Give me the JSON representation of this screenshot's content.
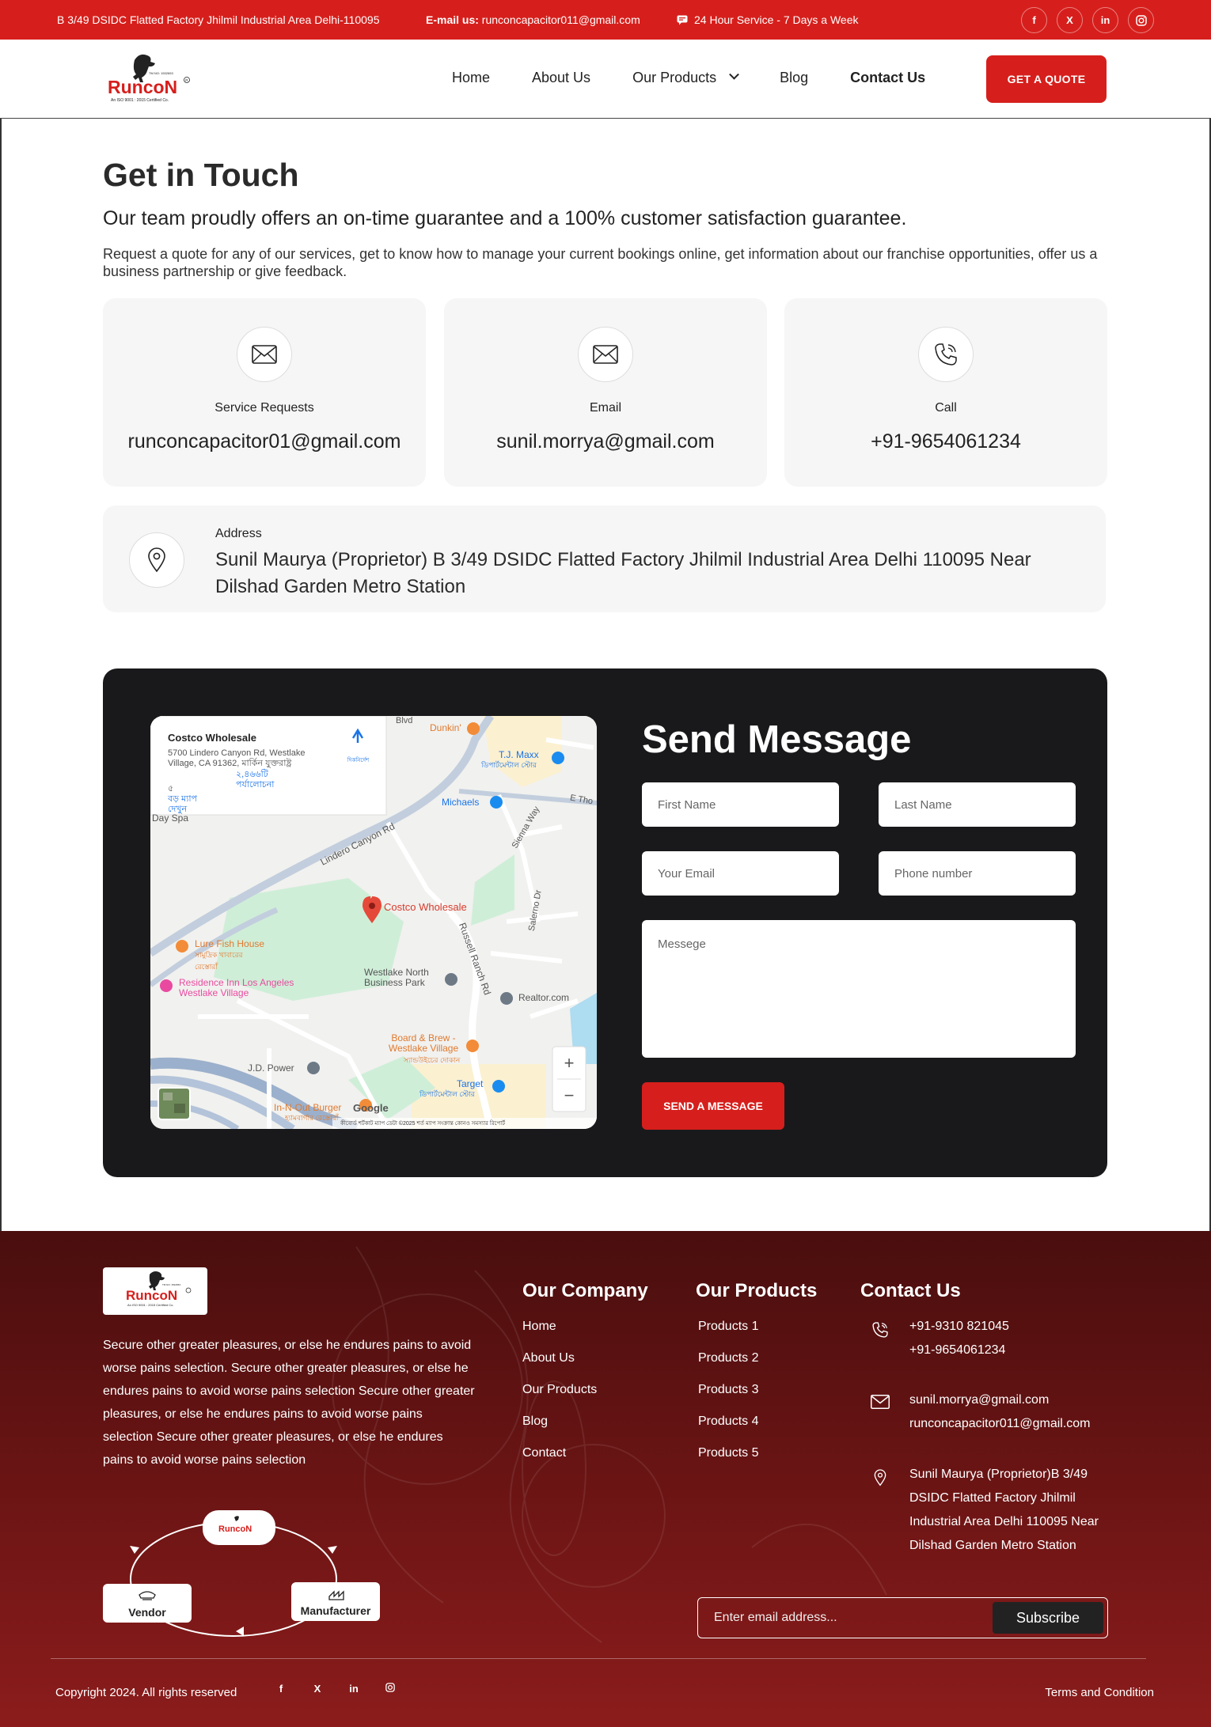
{
  "topbar": {
    "address": "B 3/49 DSIDC Flatted Factory Jhilmil Industrial Area Delhi-110095",
    "email_label": "E-mail us:",
    "email": "runconcapacitor011@gmail.com",
    "service": "24 Hour Service - 7 Days a Week",
    "socials": [
      "f",
      "X",
      "in",
      "ig"
    ]
  },
  "brand": {
    "name": "RuncoN",
    "tm": "TM NO: 1532653",
    "tagline": "An ISO 9001 : 2015 Certified Co."
  },
  "nav": {
    "items": [
      "Home",
      "About Us",
      "Our Products",
      "Blog",
      "Contact Us"
    ],
    "active": "Contact Us",
    "cta": "GET A QUOTE"
  },
  "touch": {
    "title": "Get in Touch",
    "subtitle": "Our team proudly offers an on-time guarantee and a 100% customer satisfaction guarantee.",
    "description": "Request a quote for any of our services, get to know how to manage your current bookings online, get information about our franchise opportunities, offer us a business partnership or give feedback."
  },
  "cards": [
    {
      "label": "Service Requests",
      "value": "runconcapacitor01@gmail.com",
      "icon": "mail-icon"
    },
    {
      "label": "Email",
      "value": "sunil.morrya@gmail.com",
      "icon": "mail-icon"
    },
    {
      "label": "Call",
      "value": "+91-9654061234",
      "icon": "phone-icon"
    }
  ],
  "address_card": {
    "label": "Address",
    "value": "Sunil Maurya (Proprietor) B 3/49 DSIDC Flatted Factory Jhilmil Industrial Area Delhi 110095 Near Dilshad Garden Metro Station"
  },
  "map": {
    "place_title": "Costco Wholesale",
    "place_address": "5700 Lindero Canyon Rd, Westlake Village, CA 91362, মার্কিন যুক্তরাষ্ট্র",
    "reviews": "২,৪৬৬টি পর্যালোচনা",
    "directions": "দিকনির্দেশ",
    "bigger_map": "বড় ম্যাপ দেখুন",
    "rating": "৫",
    "labels": {
      "pin": "Costco Wholesale",
      "dunkin": "Dunkin'",
      "tjmaxx": "T.J. Maxx",
      "tjmaxx_sub": "ডিপার্টমেন্টাল স্টোর",
      "michaels": "Michaels",
      "lindero": "Lindero Canyon Rd",
      "sienna": "Sienna Way",
      "salerno": "Salerno Dr",
      "russell": "Russell Ranch Rd",
      "ethorn": "E Tho",
      "lure": "Lure Fish House",
      "lure_sub": "সামুদ্রিক খাবারের রেস্তোরাঁ",
      "residence": "Residence Inn Los Angeles Westlake Village",
      "westlake": "Westlake North Business Park",
      "realtor": "Realtor.com",
      "board": "Board & Brew - Westlake Village",
      "board_sub": "স্যান্ডউইচের দোকান",
      "jd": "J.D. Power",
      "target": "Target",
      "target_sub": "ডিপার্টমেন্টাল স্টোর",
      "innout": "In-N-Out Burger",
      "innout_sub": "হ্যামবার্গার রেস্তোরাঁ",
      "dayspa": "Day Spa",
      "blvd": "Blvd",
      "google": "Google",
      "footer_text": "কীবোর্ড শর্টকাট   ম্যাপ ডেটা ©2025   শর্ত   ম্যাপ সংক্রান্ত কোনও সমস্যার রিপোর্ট"
    },
    "zoom_in": "+",
    "zoom_out": "−"
  },
  "form": {
    "title": "Send Message",
    "first_name": "First Name",
    "last_name": "Last Name",
    "email": "Your Email",
    "phone": "Phone number",
    "message": "Messege",
    "submit": "SEND A MESSAGE"
  },
  "footer": {
    "description": "Secure other greater pleasures, or else he endures pains to avoid worse pains selection. Secure other greater pleasures, or else he endures pains to avoid worse pains selection Secure other greater pleasures, or else he endures pains to avoid worse pains selection Secure other greater pleasures, or else he endures pains to avoid worse pains selection",
    "company": {
      "title": "Our Company",
      "links": [
        "Home",
        "About Us",
        "Our Products",
        "Blog",
        "Contact"
      ]
    },
    "products": {
      "title": "Our Products",
      "links": [
        "Products 1",
        "Products 2",
        "Products 3",
        "Products 4",
        "Products 5"
      ]
    },
    "contact": {
      "title": "Contact Us",
      "phones": [
        "+91-9310 821045",
        "+91-9654061234"
      ],
      "emails": [
        "sunil.morrya@gmail.com",
        "runconcapacitor011@gmail.com"
      ],
      "address": [
        "Sunil Maurya (Proprietor)B 3/49",
        "DSIDC Flatted Factory Jhilmil",
        "Industrial Area Delhi 110095 Near",
        "Dilshad Garden Metro Station"
      ]
    },
    "cycle": {
      "vendor": "Vendor",
      "manufacturer": "Manufacturer"
    },
    "subscribe": {
      "placeholder": "Enter email address...",
      "button": "Subscribe"
    },
    "copyright": "Copyright 2024. All rights reserved",
    "socials": [
      "f",
      "X",
      "in",
      "ig"
    ],
    "terms": "Terms and Condition"
  },
  "colors": {
    "brand_red": "#d61f1c",
    "dark_panel": "#19191b",
    "footer_dark": "#4a0e0e"
  }
}
